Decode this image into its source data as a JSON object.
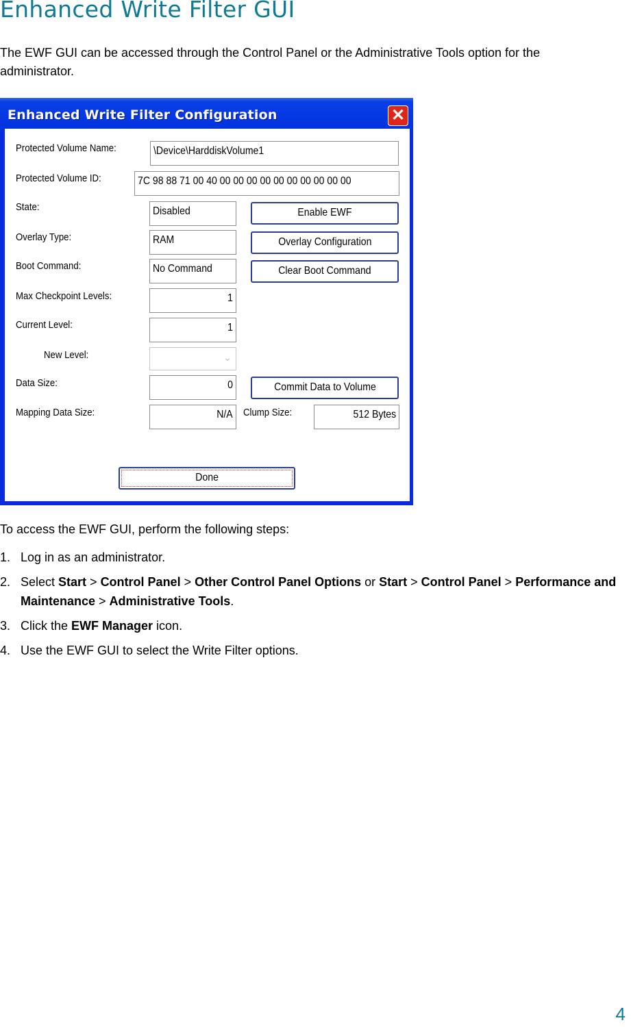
{
  "page": {
    "title": "Enhanced Write Filter GUI",
    "intro": "The EWF GUI can be accessed through the Control Panel or the Administrative Tools option for the administrator.",
    "page_number": "4"
  },
  "dialog": {
    "title": "Enhanced Write Filter Configuration",
    "close_icon": "close-icon",
    "fields": {
      "protected_volume_name": {
        "label": "Protected Volume Name:",
        "value": "\\Device\\HarddiskVolume1"
      },
      "protected_volume_id": {
        "label": "Protected Volume ID:",
        "value": "7C 98 88 71 00 40 00 00 00 00 00 00 00 00 00 00"
      },
      "state": {
        "label": "State:",
        "value": "Disabled"
      },
      "overlay_type": {
        "label": "Overlay Type:",
        "value": "RAM"
      },
      "boot_command": {
        "label": "Boot Command:",
        "value": "No Command"
      },
      "max_checkpoint_levels": {
        "label": "Max Checkpoint Levels:",
        "value": "1"
      },
      "current_level": {
        "label": "Current Level:",
        "value": "1"
      },
      "new_level": {
        "label": "New Level:",
        "value": ""
      },
      "data_size": {
        "label": "Data Size:",
        "value": "0"
      },
      "mapping_data_size": {
        "label": "Mapping Data Size:",
        "value": "N/A"
      },
      "clump_size": {
        "label": "Clump Size:",
        "value": "512 Bytes"
      }
    },
    "buttons": {
      "enable_ewf": "Enable EWF",
      "overlay_configuration": "Overlay Configuration",
      "clear_boot_command": "Clear Boot Command",
      "commit_data": "Commit Data to Volume",
      "done": "Done"
    }
  },
  "steps": {
    "intro": "To access the EWF GUI, perform the following steps:",
    "items": [
      {
        "num": "1.",
        "parts": [
          {
            "t": "Log in as an administrator.",
            "b": false
          }
        ]
      },
      {
        "num": "2.",
        "parts": [
          {
            "t": "Select ",
            "b": false
          },
          {
            "t": "Start",
            "b": true
          },
          {
            "t": " > ",
            "b": false
          },
          {
            "t": "Control Panel",
            "b": true
          },
          {
            "t": " > ",
            "b": false
          },
          {
            "t": "Other Control Panel Options",
            "b": true
          },
          {
            "t": " or ",
            "b": false
          },
          {
            "t": "Start",
            "b": true
          },
          {
            "t": " > ",
            "b": false
          },
          {
            "t": "Control Panel",
            "b": true
          },
          {
            "t": " > ",
            "b": false
          },
          {
            "t": "Performance and Maintenance",
            "b": true
          },
          {
            "t": " > ",
            "b": false
          },
          {
            "t": "Administrative Tools",
            "b": true
          },
          {
            "t": ".",
            "b": false
          }
        ]
      },
      {
        "num": "3.",
        "parts": [
          {
            "t": "Click the ",
            "b": false
          },
          {
            "t": "EWF Manager",
            "b": true
          },
          {
            "t": " icon.",
            "b": false
          }
        ]
      },
      {
        "num": "4.",
        "parts": [
          {
            "t": "Use the EWF GUI to select the Write Filter options.",
            "b": false
          }
        ]
      }
    ]
  },
  "colors": {
    "heading": "#0e7a96",
    "titlebar": "#0a2ae0",
    "close": "#e0261a"
  }
}
